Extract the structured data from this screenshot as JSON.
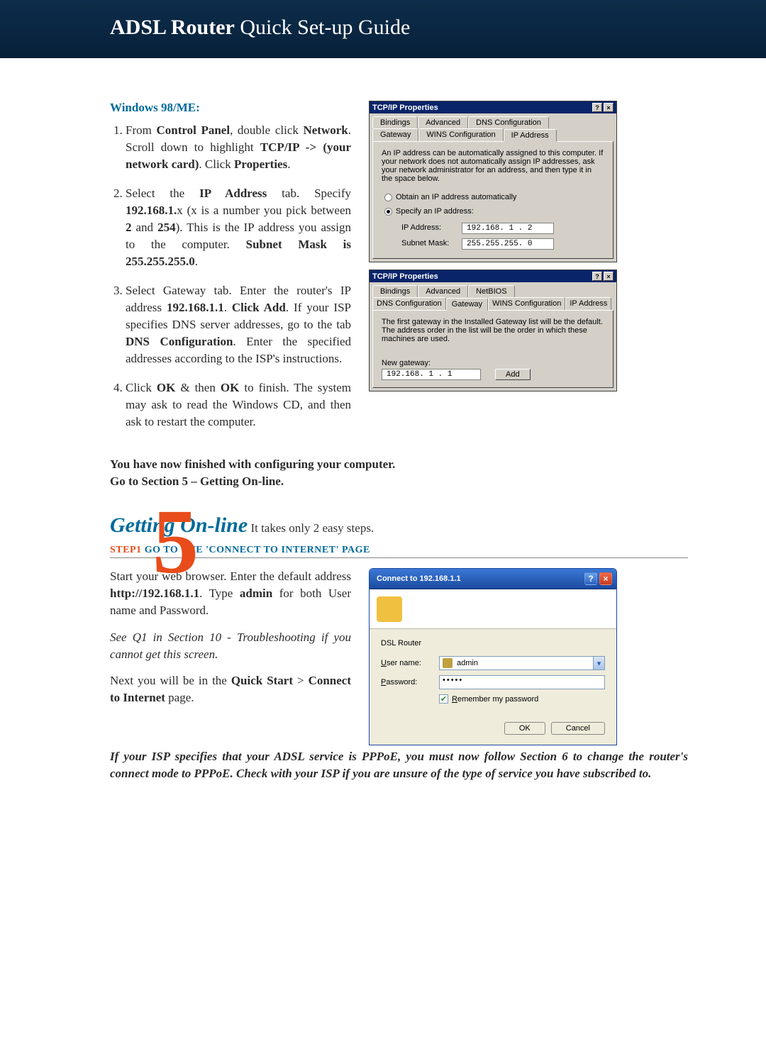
{
  "header": {
    "bold": "ADSL Router",
    "rest": " Quick Set-up Guide"
  },
  "win98_section_label": "Windows 98/ME:",
  "steps": {
    "s1": {
      "a": "From ",
      "b": "Control Panel",
      "c": ", double click ",
      "d": "Network",
      "e": ". Scroll down to highlight ",
      "f": "TCP/IP -> (your network card)",
      "g": ". Click ",
      "h": "Properties",
      "i": "."
    },
    "s2": {
      "a": "Select the ",
      "b": "IP Address",
      "c": " tab. Specify ",
      "d": "192.168.1.",
      "e": "x (x is a number you pick between ",
      "f": "2",
      "g": " and ",
      "h": "254",
      "i": "). This is the IP address you assign to the computer. ",
      "j": "Subnet Mask is 255.255.255.0",
      "k": "."
    },
    "s3": {
      "a": "Select Gateway tab. Enter the router's IP address ",
      "b": "192.168.1.1",
      "c": ". ",
      "d": "Click Add",
      "e": ". If your ISP specifies DNS server addresses, go to the tab ",
      "f": "DNS Configuration",
      "g": ". Enter the specified addresses according to the ISP's instructions."
    },
    "s4": {
      "a": "Click ",
      "b": "OK",
      "c": " & then ",
      "d": "OK",
      "e": " to finish. The system may ask to read the Windows CD, and then ask to restart the computer."
    }
  },
  "finished": {
    "a": "You have now finished with configuring your computer.",
    "b": "Go to Section 5 – Getting On-line."
  },
  "dlg1": {
    "title": "TCP/IP Properties",
    "tabs_row1": [
      "Bindings",
      "Advanced",
      "DNS Configuration"
    ],
    "tabs_row2": [
      "Gateway",
      "WINS Configuration",
      "IP Address"
    ],
    "body_text": "An IP address can be automatically assigned to this computer. If your network does not automatically assign IP addresses, ask your network administrator for an address, and then type it in the space below.",
    "radio_auto": "Obtain an IP address automatically",
    "radio_spec": "Specify an IP address:",
    "ip_label": "IP Address:",
    "ip_value": "192.168. 1 . 2",
    "mask_label": "Subnet Mask:",
    "mask_value": "255.255.255. 0"
  },
  "dlg2": {
    "title": "TCP/IP Properties",
    "tabs_row1": [
      "Bindings",
      "Advanced",
      "NetBIOS"
    ],
    "tabs_row2": [
      "DNS Configuration",
      "Gateway",
      "WINS Configuration",
      "IP Address"
    ],
    "body_text": "The first gateway in the Installed Gateway list will be the default. The address order in the list will be the order in which these machines are used.",
    "new_gw_label": "New gateway:",
    "new_gw_value": "192.168. 1 . 1",
    "add_btn": "Add"
  },
  "sec5": {
    "title": "Getting On-line",
    "sub": "  It takes only 2 easy steps.",
    "step_n": "STEP1",
    "step_t": "    GO TO THE 'CONNECT TO INTERNET' PAGE",
    "p1": {
      "a": "Start your web browser. Enter the default address ",
      "b": "http://192.168.1.1",
      "c": ". Type ",
      "d": "admin",
      "e": " for both User name and Password."
    },
    "p2": {
      "a": "See ",
      "b": "Q1 in Section 10 - Troubleshooting if you cannot get this screen."
    },
    "p3": {
      "a": "Next you will be in the ",
      "b": "Quick Start",
      "c": " > ",
      "d": "Connect to Internet",
      "e": " page."
    },
    "p4": "If your ISP specifies that your ADSL service is PPPoE, you must now follow Section 6 to change the router's connect mode to PPPoE. Check with your ISP if you are unsure of the type of service you have subscribed to."
  },
  "xp": {
    "title": "Connect to 192.168.1.1",
    "realm": "DSL Router",
    "user_label": "User name:",
    "user_value": "admin",
    "pass_label": "Password:",
    "pass_value": "•••••",
    "remember": "Remember my password",
    "ok": "OK",
    "cancel": "Cancel"
  }
}
